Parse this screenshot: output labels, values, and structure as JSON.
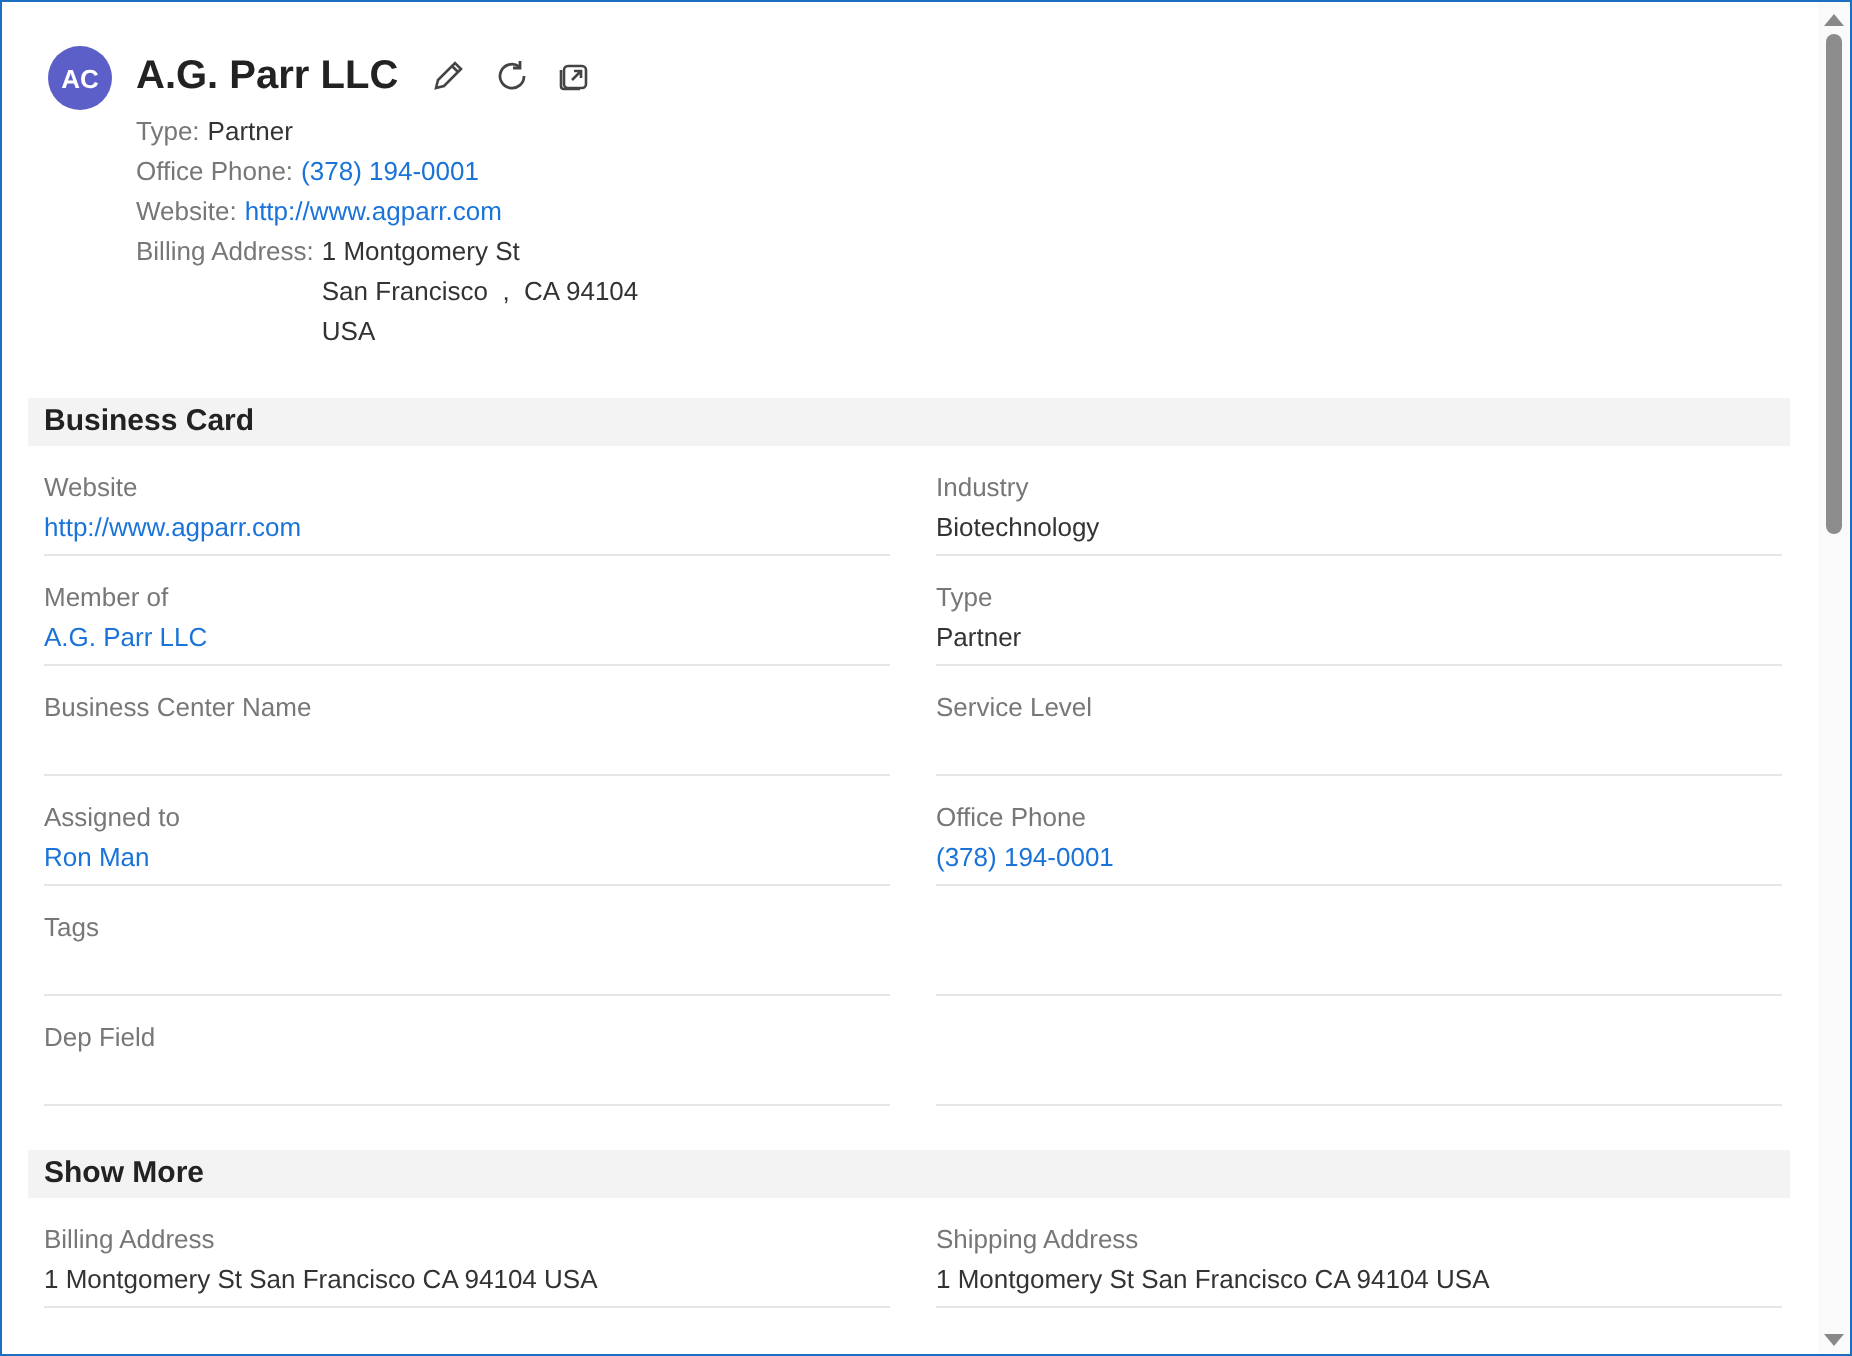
{
  "header": {
    "avatar": "AC",
    "title": "A.G. Parr LLC",
    "details": [
      {
        "label": "Type:",
        "kind": "text",
        "lines": [
          "Partner"
        ]
      },
      {
        "label": "Office Phone:",
        "kind": "link",
        "lines": [
          "(378) 194-0001"
        ]
      },
      {
        "label": "Website:",
        "kind": "link",
        "lines": [
          "http://www.agparr.com"
        ]
      },
      {
        "label": "Billing Address:",
        "kind": "text",
        "lines": [
          "1 Montgomery St",
          "San Francisco  ,  CA 94104",
          "USA"
        ]
      }
    ]
  },
  "sections": [
    {
      "title": "Business Card",
      "rows": [
        {
          "left": {
            "label": "Website",
            "value": "http://www.agparr.com",
            "kind": "link"
          },
          "right": {
            "label": "Industry",
            "value": "Biotechnology",
            "kind": "text"
          }
        },
        {
          "left": {
            "label": "Member of",
            "value": "A.G. Parr LLC",
            "kind": "link"
          },
          "right": {
            "label": "Type",
            "value": "Partner",
            "kind": "text"
          }
        },
        {
          "left": {
            "label": "Business Center Name"
          },
          "right": {
            "label": "Service Level"
          }
        },
        {
          "left": {
            "label": "Assigned to",
            "value": "Ron Man",
            "kind": "link"
          },
          "right": {
            "label": "Office Phone",
            "value": "(378) 194-0001",
            "kind": "link"
          }
        },
        {
          "left": {
            "label": "Tags"
          },
          "right": null
        },
        {
          "left": {
            "label": "Dep Field"
          },
          "right": null
        }
      ]
    },
    {
      "title": "Show More",
      "rows": [
        {
          "left": {
            "label": "Billing Address",
            "value": "1 Montgomery St San Francisco CA 94104 USA",
            "kind": "text"
          },
          "right": {
            "label": "Shipping Address",
            "value": "1 Montgomery St San Francisco CA 94104 USA",
            "kind": "text"
          }
        }
      ]
    }
  ]
}
